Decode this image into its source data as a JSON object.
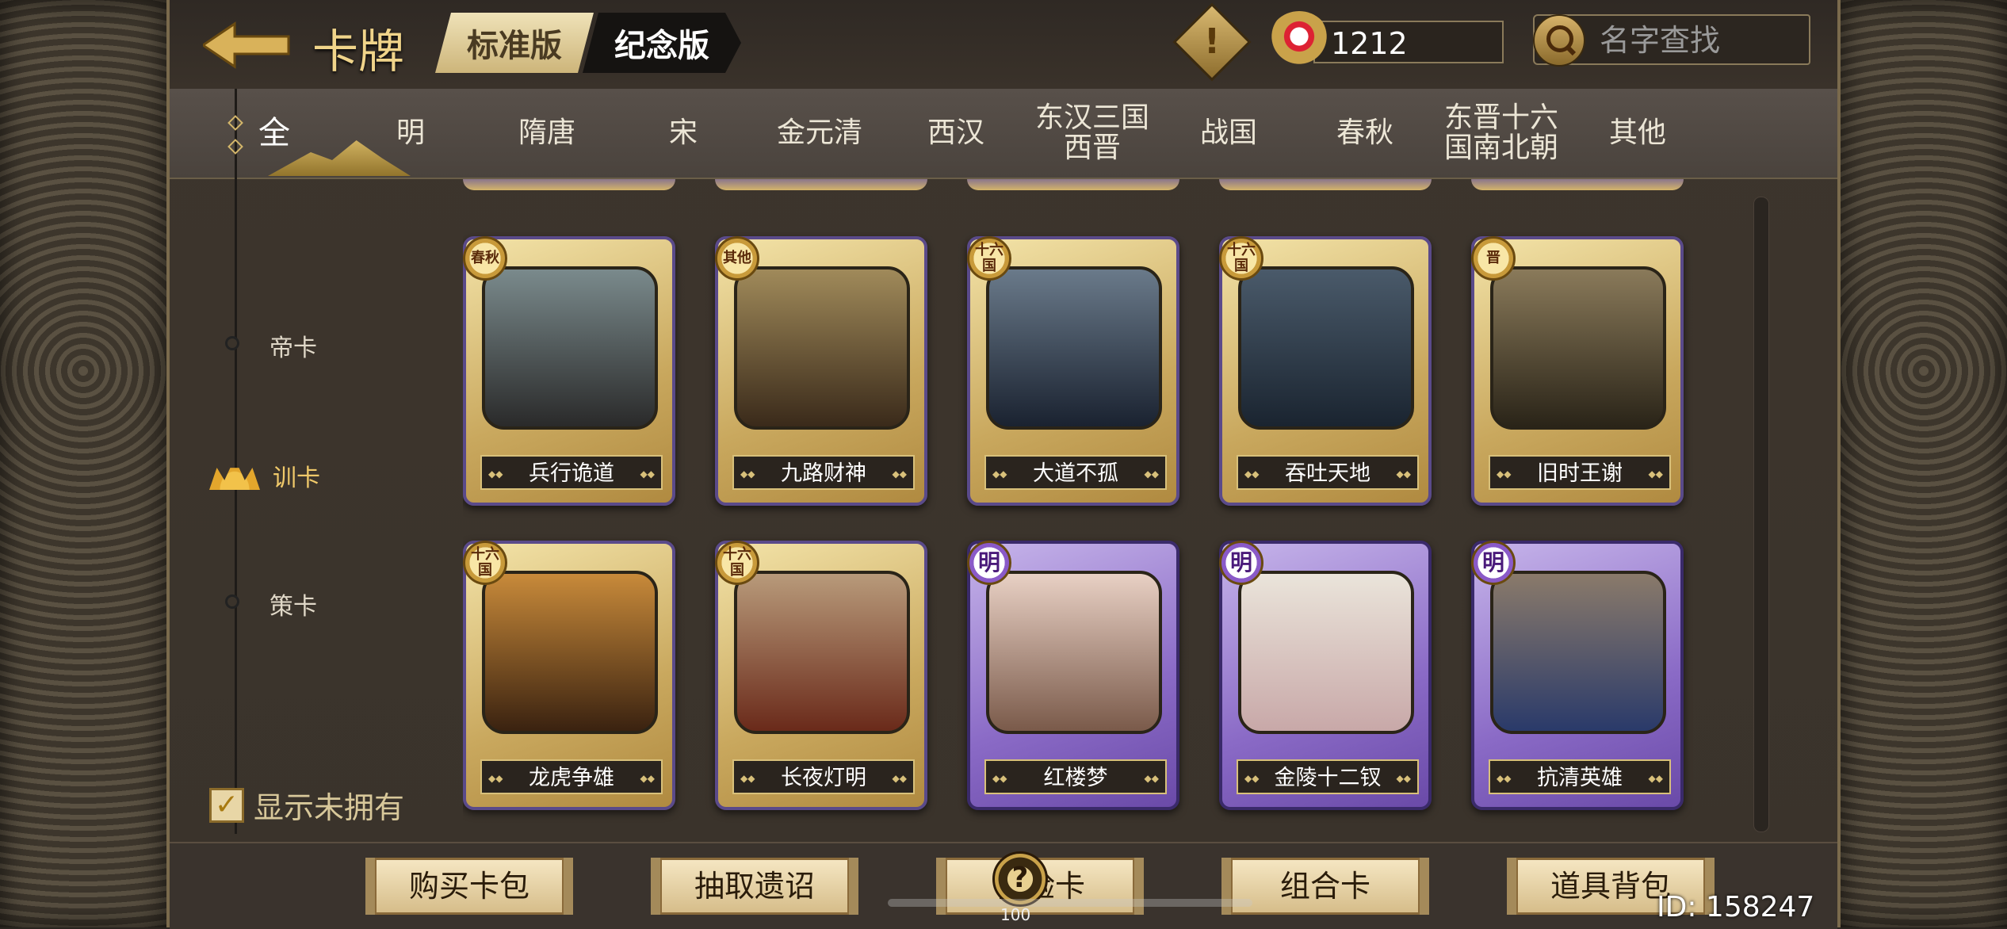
{
  "header": {
    "title": "卡牌",
    "edition_tabs": [
      {
        "label": "标准版",
        "active": true
      },
      {
        "label": "纪念版",
        "active": false
      }
    ],
    "currency_value": "1212",
    "search_placeholder": "名字查找"
  },
  "dynasty_tabs": [
    {
      "label": "全",
      "active": true
    },
    {
      "label": "明"
    },
    {
      "label": "隋唐"
    },
    {
      "label": "宋"
    },
    {
      "label": "金元清"
    },
    {
      "label": "西汉"
    },
    {
      "label": "东汉三国\n西晋"
    },
    {
      "label": "战国"
    },
    {
      "label": "春秋"
    },
    {
      "label": "东晋十六\n国南北朝"
    },
    {
      "label": "其他"
    }
  ],
  "categories": [
    {
      "label": "帝卡",
      "active": false
    },
    {
      "label": "训卡",
      "active": true
    },
    {
      "label": "策卡",
      "active": false
    }
  ],
  "cards_row1": [
    {
      "name": "兵行诡道",
      "badge": "春秋",
      "style": "gold"
    },
    {
      "name": "九路财神",
      "badge": "其他",
      "style": "gold"
    },
    {
      "name": "大道不孤",
      "badge": "十六国",
      "style": "gold"
    },
    {
      "name": "吞吐天地",
      "badge": "十六国",
      "style": "gold"
    },
    {
      "name": "旧时王谢",
      "badge": "晋",
      "style": "gold"
    }
  ],
  "cards_row2": [
    {
      "name": "龙虎争雄",
      "badge": "十六国",
      "style": "gold"
    },
    {
      "name": "长夜灯明",
      "badge": "十六国",
      "style": "gold"
    },
    {
      "name": "红楼梦",
      "badge": "明",
      "style": "purple"
    },
    {
      "name": "金陵十二钗",
      "badge": "明",
      "style": "purple"
    },
    {
      "name": "抗清英雄",
      "badge": "明",
      "style": "purple"
    }
  ],
  "show_unowned": {
    "label": "显示未拥有",
    "checked": true
  },
  "bottom_buttons": [
    {
      "label": "购买卡包"
    },
    {
      "label": "抽取遗诏"
    },
    {
      "label": "体验卡"
    },
    {
      "label": "组合卡"
    },
    {
      "label": "道具背包"
    }
  ],
  "relic_badge": {
    "count": "100"
  },
  "player_id": "ID: 158247",
  "colors": {
    "accent_gold": "#f0d48a",
    "card_gold": "#c9a85e",
    "card_purple": "#8a6ac6"
  }
}
